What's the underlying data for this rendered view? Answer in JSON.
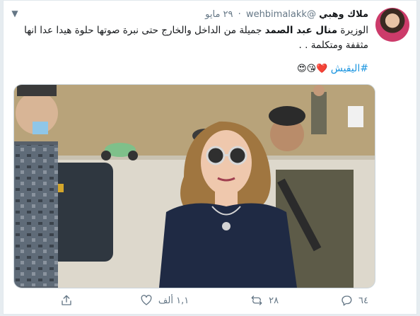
{
  "tweet": {
    "display_name": "ملاك وهبي",
    "handle": "@wehbimalakk",
    "separator": "·",
    "date": "٢٩ مايو",
    "text_prefix": "الوزيرة ",
    "text_bold": "منال عبد الصمد",
    "text_rest": " جميلة من الداخل والخارج حتى نبرة صوتها حلوة هيدا عدا انها مثقفة ومتكلمة  . .",
    "hashtag": "#اليقيش",
    "emojis": "❤️😘😍"
  },
  "actions": {
    "reply_count": "٦٤",
    "retweet_count": "٢٨",
    "like_count": "١,١ ألف",
    "share_label": ""
  },
  "icons": [
    "chevron-down-icon",
    "reply-icon",
    "retweet-icon",
    "like-icon",
    "share-icon"
  ],
  "colors": {
    "link": "#1b95e0",
    "muted": "#657786",
    "like": "#e0245e"
  }
}
